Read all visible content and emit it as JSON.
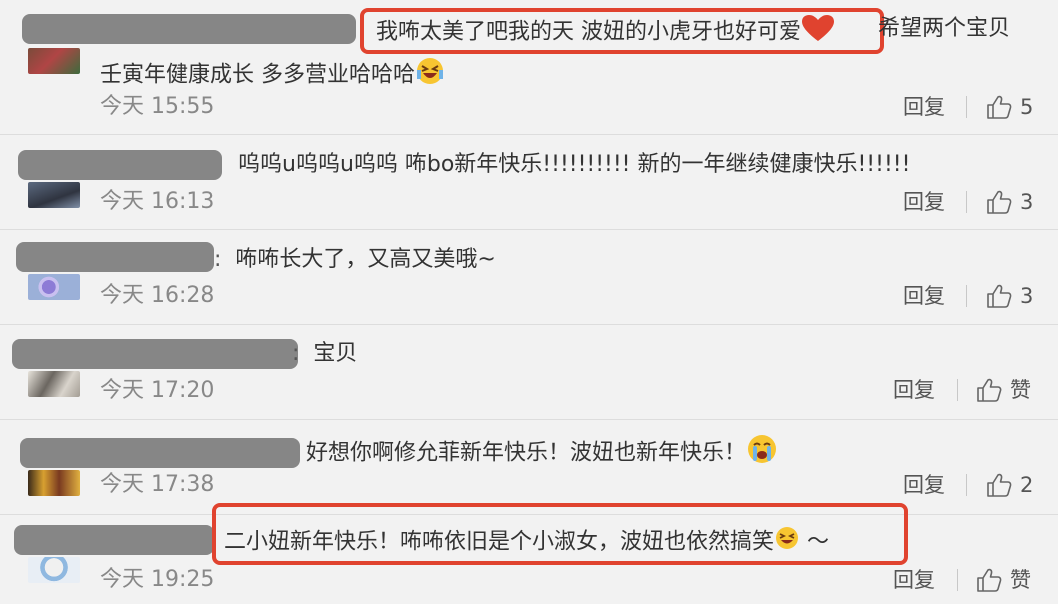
{
  "accent_color": "#e0432f",
  "comments": [
    {
      "text_line1": "我咘太美了吧我的天 波妞的小虎牙也好可爱",
      "text_line1b": "希望两个宝贝",
      "text_line2": "壬寅年健康成长 多多营业哈哈哈",
      "emoji_1": "heart-icon",
      "emoji_2": "laughing-face-icon",
      "time": "今天 15:55",
      "reply_label": "回复",
      "likes": "5"
    },
    {
      "text": "呜呜u呜呜u呜呜 咘bo新年快乐!!!!!!!!!! 新的一年继续健康快乐!!!!!!",
      "time": "今天 16:13",
      "reply_label": "回复",
      "likes": "3"
    },
    {
      "text": "咘咘长大了，又高又美哦~",
      "prefix": ":",
      "time": "今天 16:28",
      "reply_label": "回复",
      "likes": "3"
    },
    {
      "text": "宝贝",
      "prefix": ":",
      "time": "今天 17:20",
      "reply_label": "回复",
      "likes": "赞"
    },
    {
      "text": "好想你啊修允菲新年快乐！波妞也新年快乐！",
      "emoji": "crying-face-icon",
      "time": "今天 17:38",
      "reply_label": "回复",
      "likes": "2"
    },
    {
      "text": "二小妞新年快乐！咘咘依旧是个小淑女，波妞也依然搞笑",
      "suffix": " ～",
      "emoji": "grinning-squint-face-icon",
      "time": "今天 19:25",
      "reply_label": "回复",
      "likes": "赞"
    }
  ]
}
